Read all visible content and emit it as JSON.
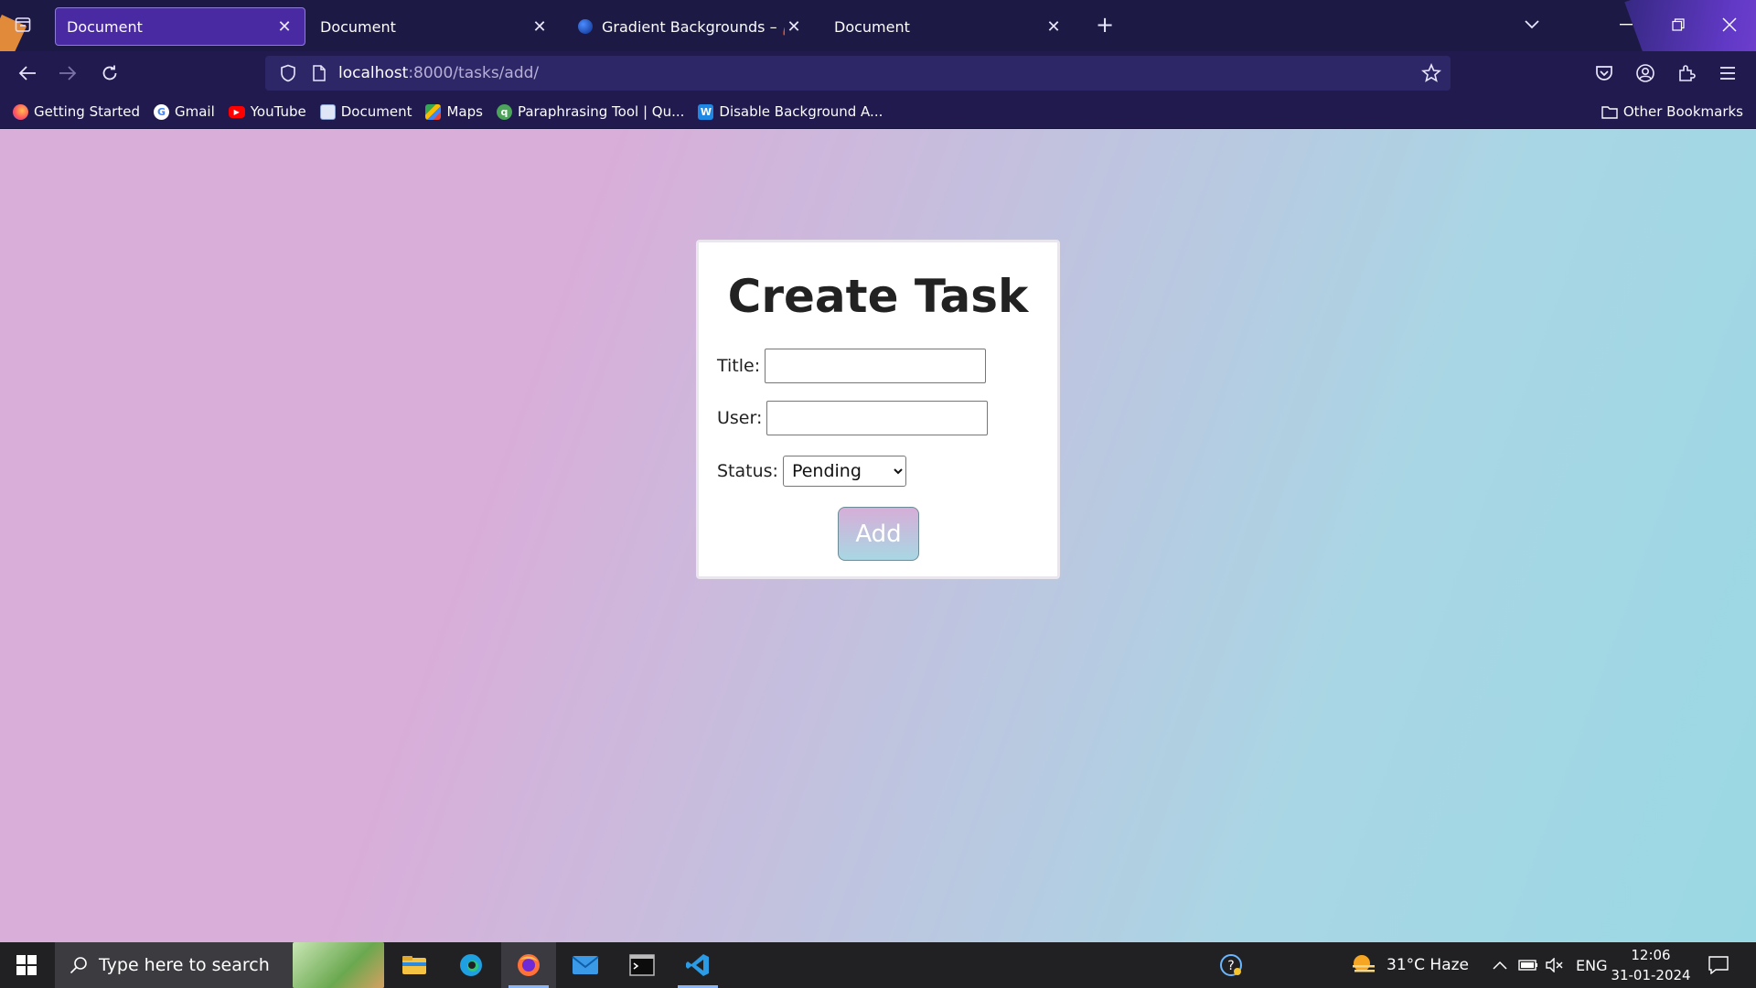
{
  "browser": {
    "tabs": [
      {
        "title": "Document",
        "active": true
      },
      {
        "title": "Document",
        "active": false
      },
      {
        "title": "Gradient Backgrounds – 🌈 The",
        "active": false
      },
      {
        "title": "Document",
        "active": false
      }
    ],
    "url_host": "localhost",
    "url_path": ":8000/tasks/add/",
    "bookmarks": [
      {
        "label": "Getting Started",
        "icon": "firefox-icon"
      },
      {
        "label": "Gmail",
        "icon": "google-icon"
      },
      {
        "label": "YouTube",
        "icon": "youtube-icon"
      },
      {
        "label": "Document",
        "icon": "document-icon"
      },
      {
        "label": "Maps",
        "icon": "maps-icon"
      },
      {
        "label": "Paraphrasing Tool | Qu...",
        "icon": "quillbot-icon"
      },
      {
        "label": "Disable Background A...",
        "icon": "w-icon"
      }
    ],
    "other_bookmarks": "Other Bookmarks"
  },
  "page": {
    "heading": "Create Task",
    "title_label": "Title:",
    "title_value": "",
    "user_label": "User:",
    "user_value": "",
    "status_label": "Status:",
    "status_value": "Pending",
    "add_button": "Add"
  },
  "taskbar": {
    "search_placeholder": "Type here to search",
    "weather": "31°C  Haze",
    "language": "ENG",
    "time": "12:06",
    "date": "31-01-2024"
  },
  "colors": {
    "gradient_start": "#d9aed9",
    "gradient_end": "#9ad8e4",
    "browser_chrome": "#201a4e"
  }
}
